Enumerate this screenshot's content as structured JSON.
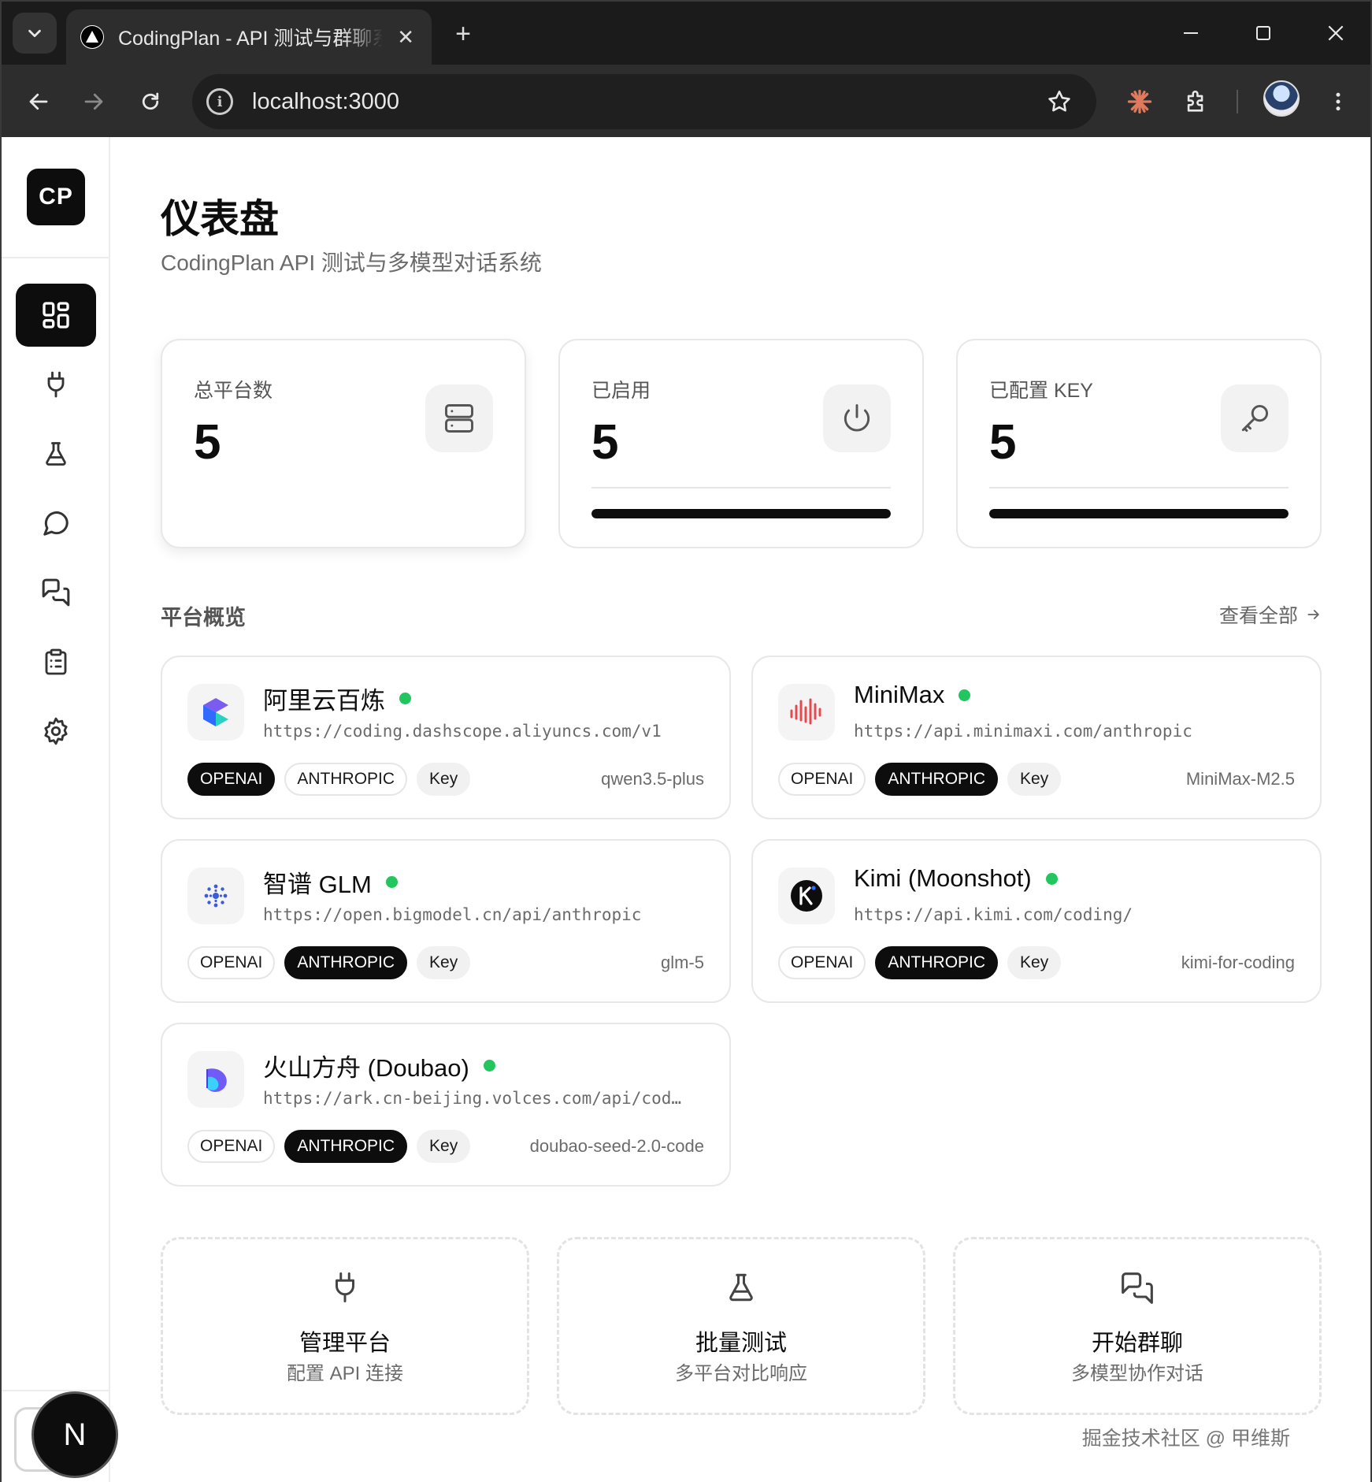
{
  "browser": {
    "tab_title": "CodingPlan - API 测试与群聊系统",
    "tab_close": "✕",
    "new_tab": "+",
    "url": "localhost:3000"
  },
  "sidebar": {
    "logo": "CP",
    "items": [
      {
        "icon": "dashboard-grid-icon",
        "active": true
      },
      {
        "icon": "plug-icon",
        "active": false
      },
      {
        "icon": "flask-icon",
        "active": false
      },
      {
        "icon": "chat-bubble-icon",
        "active": false
      },
      {
        "icon": "group-chat-icon",
        "active": false
      },
      {
        "icon": "clipboard-icon",
        "active": false
      },
      {
        "icon": "gear-icon",
        "active": false
      }
    ],
    "user_badge": "N"
  },
  "header": {
    "title": "仪表盘",
    "subtitle": "CodingPlan API 测试与多模型对话系统"
  },
  "stats": [
    {
      "label": "总平台数",
      "value": "5",
      "icon": "server-icon"
    },
    {
      "label": "已启用",
      "value": "5",
      "icon": "power-icon",
      "progress": 1.0
    },
    {
      "label": "已配置 KEY",
      "value": "5",
      "icon": "key-icon",
      "progress": 1.0
    }
  ],
  "overview": {
    "title": "平台概览",
    "view_all": "查看全部"
  },
  "platforms": [
    {
      "name": "阿里云百炼",
      "url": "https://coding.dashscope.aliyuncs.com/v1",
      "openai": "OPENAI",
      "anthropic": "ANTHROPIC",
      "key": "Key",
      "model": "qwen3.5-plus",
      "active_protocol": "openai",
      "status": "enabled",
      "logo": "aliyun-bailian-logo"
    },
    {
      "name": "MiniMax",
      "url": "https://api.minimaxi.com/anthropic",
      "openai": "OPENAI",
      "anthropic": "ANTHROPIC",
      "key": "Key",
      "model": "MiniMax-M2.5",
      "active_protocol": "anthropic",
      "status": "enabled",
      "logo": "minimax-logo"
    },
    {
      "name": "智谱 GLM",
      "url": "https://open.bigmodel.cn/api/anthropic",
      "openai": "OPENAI",
      "anthropic": "ANTHROPIC",
      "key": "Key",
      "model": "glm-5",
      "active_protocol": "anthropic",
      "status": "enabled",
      "logo": "zhipu-glm-logo"
    },
    {
      "name": "Kimi (Moonshot)",
      "url": "https://api.kimi.com/coding/",
      "openai": "OPENAI",
      "anthropic": "ANTHROPIC",
      "key": "Key",
      "model": "kimi-for-coding",
      "active_protocol": "anthropic",
      "status": "enabled",
      "logo": "kimi-logo"
    },
    {
      "name": "火山方舟 (Doubao)",
      "url": "https://ark.cn-beijing.volces.com/api/cod…",
      "openai": "OPENAI",
      "anthropic": "ANTHROPIC",
      "key": "Key",
      "model": "doubao-seed-2.0-code",
      "active_protocol": "anthropic",
      "status": "enabled",
      "logo": "doubao-logo"
    }
  ],
  "quick_actions": [
    {
      "title": "管理平台",
      "subtitle": "配置 API 连接",
      "icon": "plug-icon"
    },
    {
      "title": "批量测试",
      "subtitle": "多平台对比响应",
      "icon": "flask-icon"
    },
    {
      "title": "开始群聊",
      "subtitle": "多模型协作对话",
      "icon": "group-chat-icon"
    }
  ],
  "watermark": "掘金技术社区 @ 甲维斯",
  "colors": {
    "accent": "#0d0d0d",
    "status_enabled": "#22c55e",
    "muted_text": "#6b6b6b",
    "border": "#e8e8e8"
  }
}
